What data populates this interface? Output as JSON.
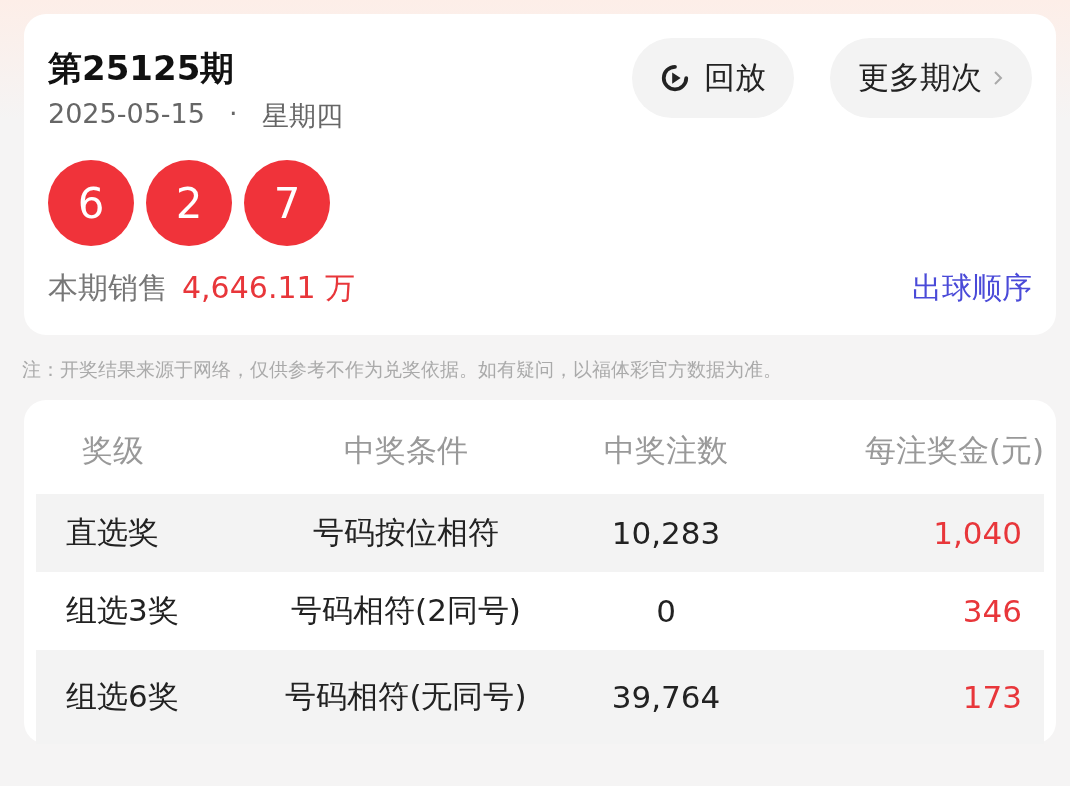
{
  "draw": {
    "issue": "第25125期",
    "date": "2025-05-15",
    "separator": "·",
    "weekday": "星期四",
    "buttons": [
      "回放",
      "更多期次"
    ],
    "balls": [
      "6",
      "2",
      "7"
    ],
    "sales_label": "本期销售",
    "sales_value": "4,646.11 万",
    "order_link": "出球顺序"
  },
  "note": "注：开奖结果来源于网络，仅供参考不作为兑奖依据。如有疑问，以福体彩官方数据为准。",
  "table": {
    "columns": [
      "奖级",
      "中奖条件",
      "中奖注数",
      "每注奖金(元)"
    ],
    "rows": [
      {
        "cells": [
          "直选奖",
          "号码按位相符",
          "10,283",
          "1,040"
        ]
      },
      {
        "cells": [
          "组选3奖",
          "号码相符(2同号)",
          "0",
          "346"
        ]
      },
      {
        "cells": [
          "组选6奖",
          "号码相符(无同号)",
          "39,764",
          "173"
        ]
      }
    ]
  }
}
